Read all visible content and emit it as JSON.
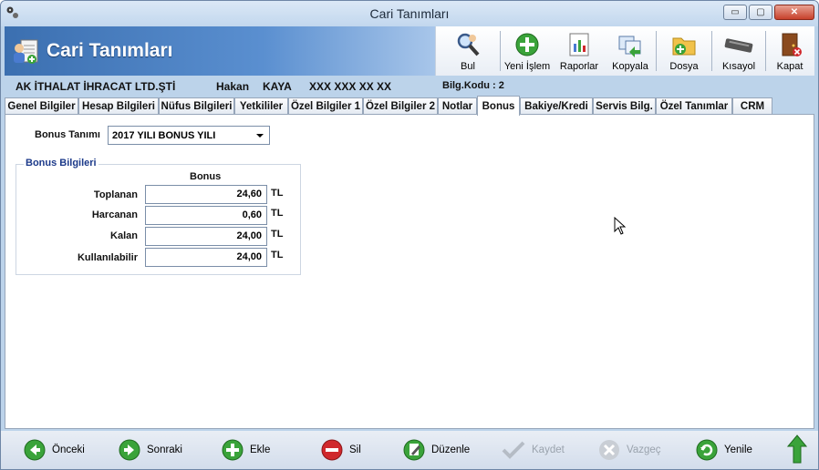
{
  "window": {
    "title": "Cari Tanımları",
    "min": "▭",
    "max": "▢",
    "close": "✕"
  },
  "banner": {
    "title": "Cari Tanımları"
  },
  "toolbar": {
    "items": [
      "Bul",
      "Yeni İşlem",
      "Raporlar",
      "Kopyala",
      "Dosya",
      "Kısayol",
      "Kapat"
    ]
  },
  "info": {
    "company": "AK İTHALAT İHRACAT LTD.ŞTİ",
    "first_name": "Hakan",
    "last_name": "KAYA",
    "phone": "XXX XXX XX XX",
    "bilg_kodu": "Bilg.Kodu : 2"
  },
  "tabs": [
    "Genel Bilgiler",
    "Hesap Bilgileri",
    "Nüfus Bilgileri",
    "Yetkililer",
    "Özel Bilgiler 1",
    "Özel Bilgiler 2",
    "Notlar",
    "Bonus",
    "Bakiye/Kredi",
    "Servis Bilg.",
    "Özel Tanımlar",
    "CRM"
  ],
  "active_tab": "Bonus",
  "form": {
    "bonus_tanimi_label": "Bonus Tanımı",
    "bonus_tanimi_value": "2017 YILI BONUS YILI",
    "group_title": "Bonus Bilgileri",
    "column_header": "Bonus",
    "rows": [
      {
        "label": "Toplanan",
        "value": "24,60",
        "unit": "TL"
      },
      {
        "label": "Harcanan",
        "value": "0,60",
        "unit": "TL"
      },
      {
        "label": "Kalan",
        "value": "24,00",
        "unit": "TL"
      },
      {
        "label": "Kullanılabilir",
        "value": "24,00",
        "unit": "TL"
      }
    ]
  },
  "bottom": {
    "items": [
      {
        "label": "Önceki",
        "enabled": true
      },
      {
        "label": "Sonraki",
        "enabled": true
      },
      {
        "label": "Ekle",
        "enabled": true
      },
      {
        "label": "Sil",
        "enabled": true
      },
      {
        "label": "Düzenle",
        "enabled": true
      },
      {
        "label": "Kaydet",
        "enabled": false
      },
      {
        "label": "Vazgeç",
        "enabled": false
      },
      {
        "label": "Yenile",
        "enabled": true
      }
    ]
  },
  "colors": {
    "accent": "#3b6fb0",
    "group_title": "#1c3a8a",
    "green": "#3aa33a",
    "red": "#d0282c"
  }
}
